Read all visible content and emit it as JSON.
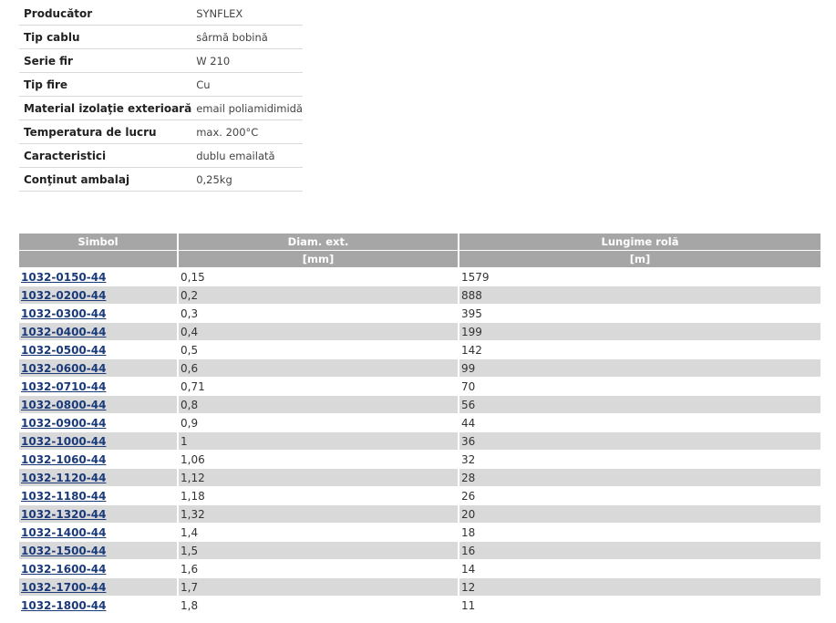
{
  "specs": [
    {
      "label": "Producător",
      "value": "SYNFLEX"
    },
    {
      "label": "Tip cablu",
      "value": "sârmă bobină"
    },
    {
      "label": "Serie fir",
      "value": "W 210"
    },
    {
      "label": "Tip fire",
      "value": "Cu"
    },
    {
      "label": "Material izolaţie exterioară",
      "value": "email poliamidimidă"
    },
    {
      "label": "Temperatura de lucru",
      "value": "max. 200°C"
    },
    {
      "label": "Caracteristici",
      "value": "dublu emailată"
    },
    {
      "label": "Conţinut ambalaj",
      "value": "0,25kg"
    }
  ],
  "table": {
    "headers": [
      "Simbol",
      "Diam. ext.",
      "Lungime rolă"
    ],
    "units": [
      "",
      "[mm]",
      "[m]"
    ],
    "rows": [
      [
        "1032-0150-44",
        "0,15",
        "1579"
      ],
      [
        "1032-0200-44",
        "0,2",
        "888"
      ],
      [
        "1032-0300-44",
        "0,3",
        "395"
      ],
      [
        "1032-0400-44",
        "0,4",
        "199"
      ],
      [
        "1032-0500-44",
        "0,5",
        "142"
      ],
      [
        "1032-0600-44",
        "0,6",
        "99"
      ],
      [
        "1032-0710-44",
        "0,71",
        "70"
      ],
      [
        "1032-0800-44",
        "0,8",
        "56"
      ],
      [
        "1032-0900-44",
        "0,9",
        "44"
      ],
      [
        "1032-1000-44",
        "1",
        "36"
      ],
      [
        "1032-1060-44",
        "1,06",
        "32"
      ],
      [
        "1032-1120-44",
        "1,12",
        "28"
      ],
      [
        "1032-1180-44",
        "1,18",
        "26"
      ],
      [
        "1032-1320-44",
        "1,32",
        "20"
      ],
      [
        "1032-1400-44",
        "1,4",
        "18"
      ],
      [
        "1032-1500-44",
        "1,5",
        "16"
      ],
      [
        "1032-1600-44",
        "1,6",
        "14"
      ],
      [
        "1032-1700-44",
        "1,7",
        "12"
      ],
      [
        "1032-1800-44",
        "1,8",
        "11"
      ]
    ]
  }
}
